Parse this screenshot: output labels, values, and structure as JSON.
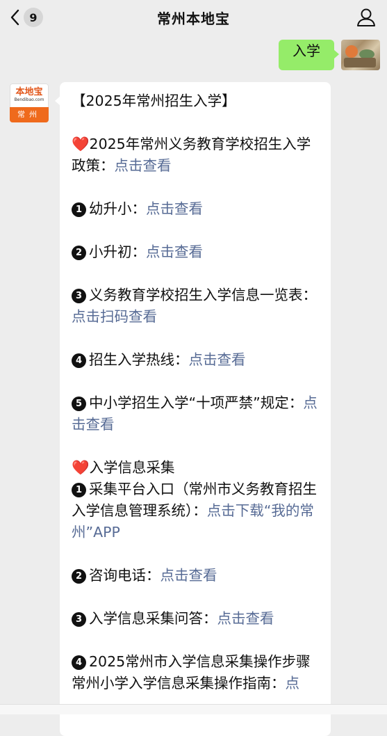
{
  "header": {
    "title": "常州本地宝",
    "unread_count": "9"
  },
  "sent_message": {
    "text": "入学"
  },
  "bot_avatar": {
    "name": "本地宝",
    "site": "Bendibao.com",
    "city": "常州"
  },
  "message": {
    "headline": "【2025年常州招生入学】",
    "sections": {
      "policy_prefix": "2025年常州义务教育学校招生入学政策：",
      "policy_link": "点击查看",
      "item1_label": "幼升小：",
      "item1_link": "点击查看",
      "item2_label": "小升初：",
      "item2_link": "点击查看",
      "item3_label": "义务教育学校招生入学信息一览表：",
      "item3_link": "点击扫码查看",
      "item4_label": "招生入学热线：",
      "item4_link": "点击查看",
      "item5_label": "中小学招生入学“十项严禁”规定：",
      "item5_link": "点击查看",
      "collect_title": "入学信息采集",
      "c1_label": "采集平台入口（常州市义务教育招生入学信息管理系统）：",
      "c1_link": "点击下载“我的常州”APP",
      "c2_label": "咨询电话：",
      "c2_link": "点击查看",
      "c3_label": "入学信息采集问答：",
      "c3_link": "点击查看",
      "c4_label": "2025常州市入学信息采集操作步骤",
      "c4_sub": "常州小学入学信息采集操作指南：",
      "c4_sub_link": "点"
    },
    "markers": [
      "❶",
      "❷",
      "❸",
      "❹",
      "❺"
    ]
  }
}
